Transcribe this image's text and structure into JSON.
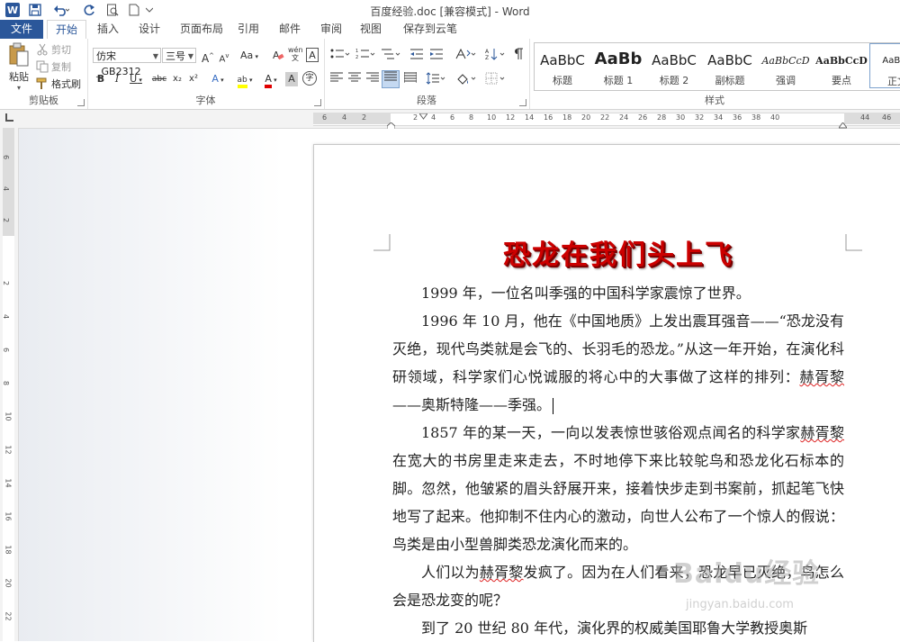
{
  "window": {
    "title": "百度经验.doc [兼容模式] - Word"
  },
  "tabs": [
    "文件",
    "开始",
    "插入",
    "设计",
    "页面布局",
    "引用",
    "邮件",
    "审阅",
    "视图",
    "保存到云笔记"
  ],
  "ribbon": {
    "clipboard": {
      "label": "剪贴板",
      "paste": "粘贴",
      "cut": "剪切",
      "copy": "复制",
      "format_painter": "格式刷"
    },
    "font": {
      "label": "字体",
      "font_name": "仿宋_GB2312",
      "font_size": "三号",
      "grow": "A",
      "shrink": "A",
      "case": "Aa",
      "phonetic": "wén",
      "border_char": "A",
      "bold": "B",
      "italic": "I",
      "underline": "U",
      "strikethrough": "abc",
      "subscript": "x₂",
      "superscript": "x²",
      "text_effect": "A",
      "highlight": "ab",
      "font_color": "A",
      "char_shading": "A",
      "enclose": "字"
    },
    "paragraph": {
      "label": "段落"
    },
    "styles": {
      "label": "样式",
      "items": [
        {
          "sample": "AaBbC",
          "name": "标题"
        },
        {
          "sample": "AaBb",
          "name": "标题 1"
        },
        {
          "sample": "AaBbC",
          "name": "标题 2"
        },
        {
          "sample": "AaBbC",
          "name": "副标题"
        },
        {
          "sample": "AaBbCcD",
          "name": "强调"
        },
        {
          "sample": "AaBbCcD",
          "name": "要点"
        },
        {
          "sample": "AaBbC",
          "name": "正文"
        }
      ]
    }
  },
  "ruler": {
    "h_ticks": [
      "6",
      "4",
      "2",
      "2",
      "4",
      "6",
      "8",
      "10",
      "12",
      "14",
      "16",
      "18",
      "20",
      "22",
      "24",
      "26",
      "28",
      "30",
      "32",
      "34",
      "36",
      "38",
      "40",
      "44",
      "46"
    ],
    "v_ticks": [
      "6",
      "4",
      "2",
      "2",
      "4",
      "6",
      "8",
      "10",
      "12",
      "14",
      "16",
      "18",
      "20",
      "22"
    ]
  },
  "document": {
    "title": "恐龙在我们头上飞",
    "paragraphs": [
      {
        "text": "1999 年，一位名叫季强的中国科学家震惊了世界。"
      },
      {
        "pre": "1996 年 10 月，他在《中国地质》上发出震耳强音——“恐龙没有灭绝，现代鸟类就是会飞的、长羽毛的恐龙。”从这一年开始，在演化科研领域，科学家们心悦诚服的将心中的大事做了这样的排列：",
        "mark": "赫胥黎",
        "post": "——奥斯特隆——季强。"
      },
      {
        "pre": "1857 年的某一天，一向以发表惊世骇俗观点闻名的科学家",
        "mark": "赫胥黎",
        "post": "在宽大的书房里走来走去，不时地停下来比较鸵鸟和恐龙化石标本的脚。忽然，他皱紧的眉头舒展开来，接着快步走到书案前，抓起笔飞快地写了起来。他抑制不住内心的激动，向世人公布了一个惊人的假说：鸟类是由小型兽脚类恐龙演化而来的。"
      },
      {
        "pre": "人们以为",
        "mark": "赫胥黎",
        "post": "发疯了。因为在人们看来，恐龙早已灭绝，鸟怎么会是恐龙变的呢？"
      },
      {
        "text": "到了 20 世纪 80 年代，演化界的权威美国耶鲁大学教授奥斯"
      }
    ]
  },
  "watermark": {
    "brand": "Baidu经验",
    "url": "jingyan.baidu.com"
  },
  "colors": {
    "accent": "#2b579a",
    "title_red": "#cc0000"
  }
}
